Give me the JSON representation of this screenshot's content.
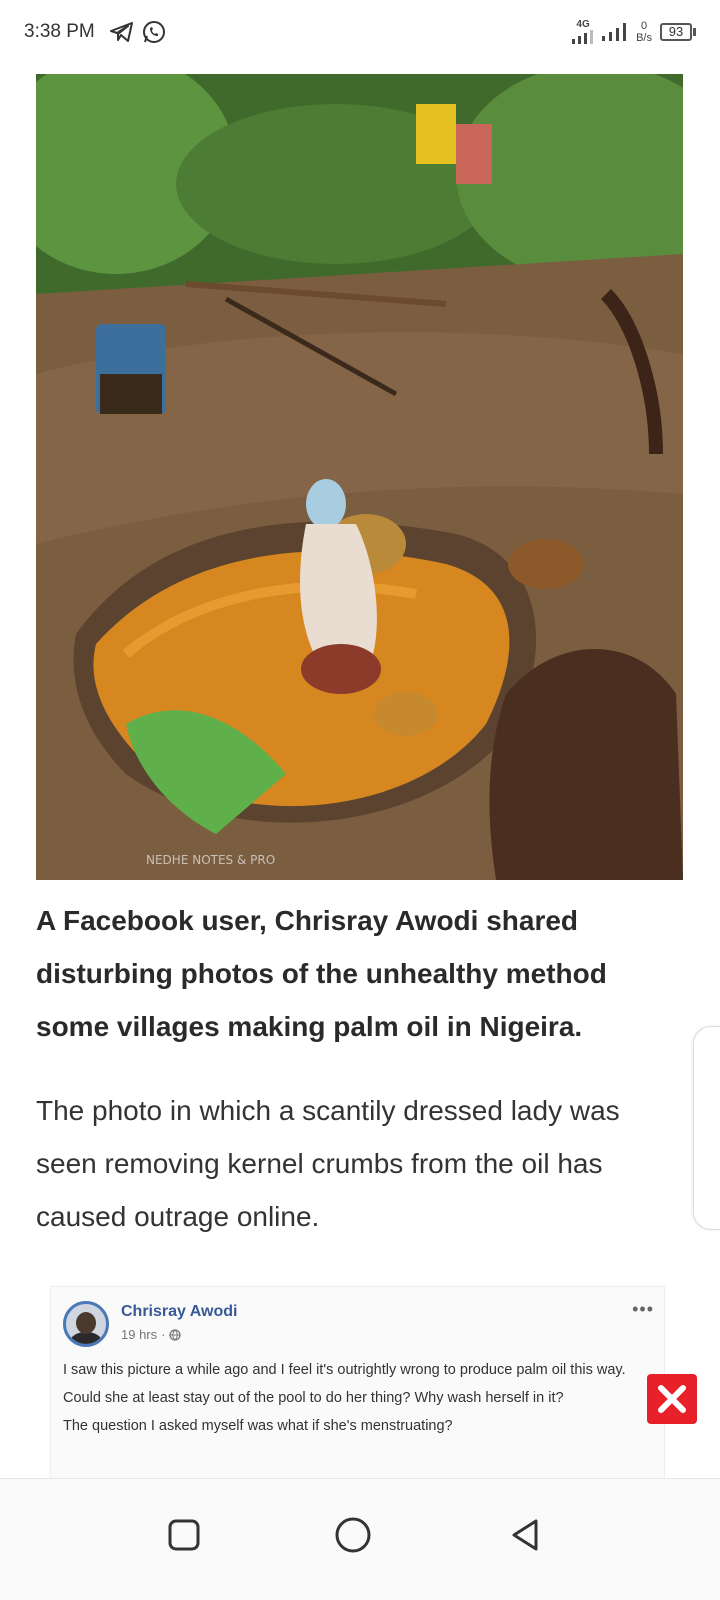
{
  "status_bar": {
    "time": "3:38 PM",
    "network_type": "4G",
    "net_speed_value": "0",
    "net_speed_unit": "B/s",
    "battery_level": "93",
    "icons": [
      "telegram-icon",
      "whatsapp-icon",
      "signal-icon",
      "signal-icon",
      "battery-icon"
    ]
  },
  "article": {
    "headline": "A Facebook user, Chrisray Awodi shared disturbing photos of the unhealthy method some villages making palm oil in Nigeira.",
    "paragraph": "The photo in which a scantily dressed lady was seen removing kernel crumbs from the oil has caused outrage online.",
    "photo_watermark": "NEDHE NOTES & PRO"
  },
  "facebook_post": {
    "author": "Chrisray Awodi",
    "time": "19 hrs",
    "audience_icon": "globe-icon",
    "more_label": "•••",
    "lines": [
      "I saw this picture a while ago and I feel it's outrightly wrong to produce palm oil this way.",
      "Could she at least stay out of the pool to do her thing? Why wash herself in it?",
      "The question I asked myself was what if she's menstruating?"
    ]
  },
  "close_button": {
    "icon": "close-icon",
    "color": "#e8202a"
  },
  "nav_bar": {
    "icons": [
      "recents-square-icon",
      "home-circle-icon",
      "back-triangle-icon"
    ]
  }
}
